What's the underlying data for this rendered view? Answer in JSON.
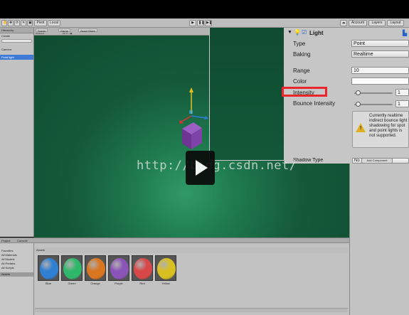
{
  "toolbar": {
    "pivot_label": "Pivot",
    "local_label": "Local",
    "account_label": "Account",
    "layers_label": "Layers",
    "layout_label": "Layout"
  },
  "hierarchy": {
    "tab_label": "Hierarchy",
    "create_label": "Create",
    "items": [
      "Camera",
      "Point light"
    ]
  },
  "scene": {
    "tabs": [
      "Scene",
      "Game",
      "Asset Store"
    ],
    "shading_mode": "Textured"
  },
  "inspector": {
    "component_title": "Light",
    "type_label": "Type",
    "type_value": "Point",
    "baking_label": "Baking",
    "baking_value": "Realtime",
    "range_label": "Range",
    "range_value": "10",
    "color_label": "Color",
    "intensity_label": "Intensity",
    "intensity_value": "1",
    "intensity_fraction": 0.1,
    "bounce_label": "Bounce Intensity",
    "bounce_value": "1",
    "bounce_fraction": 0.1,
    "warning": "Currently realtime indirect bounce light shadowing for spot and point lights is not supported.",
    "shadow_type_label": "Shadow Type",
    "shadow_type_value": "No Shadows",
    "add_component_label": "Add Component"
  },
  "project": {
    "tabs": [
      "Project",
      "Console"
    ],
    "tree": [
      "Favorites",
      "All Materials",
      "All Models",
      "All Prefabs",
      "All Scripts",
      "Assets"
    ],
    "folder_label": "Assets",
    "assets": [
      {
        "label": "Blue",
        "color": "#2f7fd2"
      },
      {
        "label": "Green",
        "color": "#2fb86a"
      },
      {
        "label": "Orange",
        "color": "#d9761f"
      },
      {
        "label": "Purple",
        "color": "#8b54b8"
      },
      {
        "label": "Red",
        "color": "#d84848"
      },
      {
        "label": "Yellow",
        "color": "#d8c021"
      }
    ]
  },
  "overlay": {
    "watermark": "http://blog.csdn.net/"
  },
  "colors": {
    "highlight_box": "#e8262c",
    "cube": "#7a3fa0",
    "viewport_green": "#1f7a4e"
  }
}
